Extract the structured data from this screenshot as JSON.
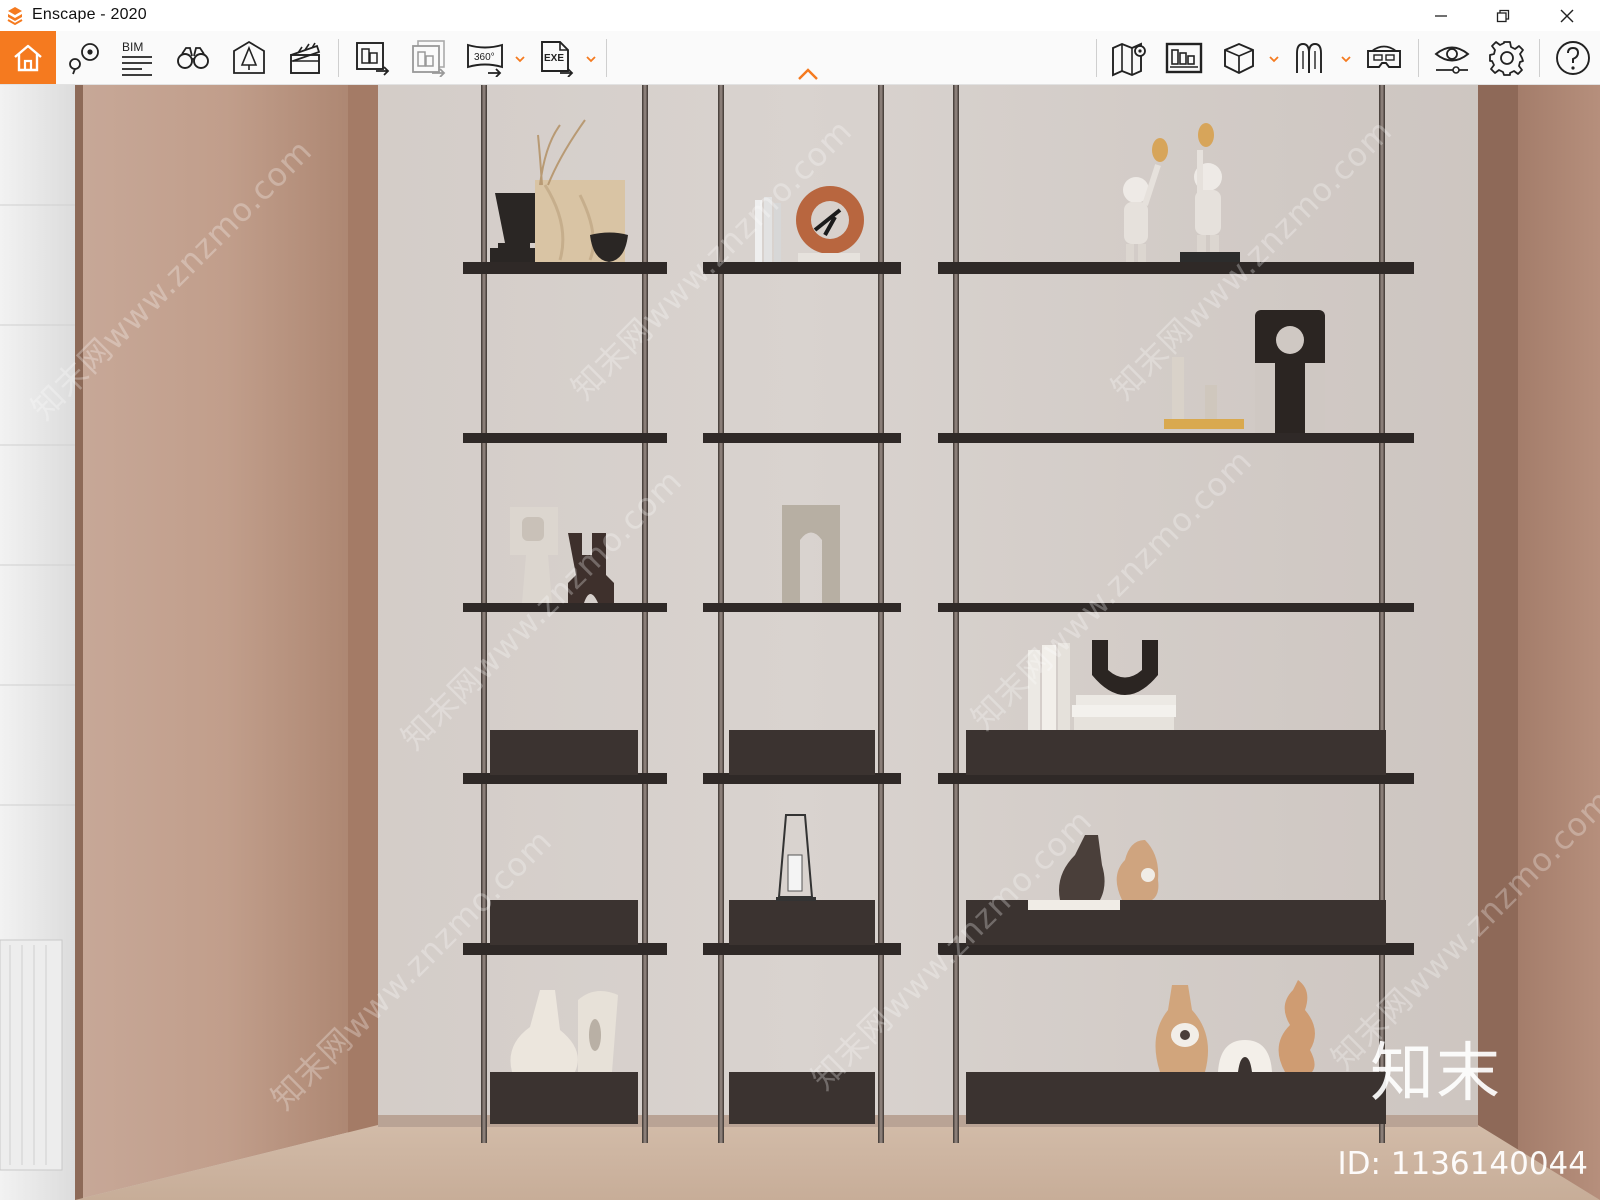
{
  "window": {
    "title": "Enscape - 2020",
    "accent": "#f57a1f"
  },
  "window_controls": [
    {
      "icon": "minimize-icon"
    },
    {
      "icon": "restore-icon"
    },
    {
      "icon": "close-icon"
    }
  ],
  "toolbar": {
    "bim_label": "BIM",
    "screenshot_360_label": "360°",
    "exe_label": "EXE",
    "left_tools": [
      {
        "name": "home",
        "icon": "home-icon"
      },
      {
        "name": "view-management",
        "icon": "location-pin-icon"
      },
      {
        "name": "bim",
        "icon": "bim-icon"
      },
      {
        "name": "walk-mode",
        "icon": "binoculars-icon"
      },
      {
        "name": "visual-settings",
        "icon": "house-outline-icon"
      },
      {
        "name": "video-editor",
        "icon": "clapperboard-icon"
      },
      {
        "name": "render-image",
        "icon": "render-image-icon"
      },
      {
        "name": "batch-render",
        "icon": "batch-render-icon"
      },
      {
        "name": "render-360",
        "icon": "panorama-360-icon"
      },
      {
        "name": "export-exe",
        "icon": "exe-export-icon"
      }
    ],
    "right_tools": [
      {
        "name": "map",
        "icon": "map-icon"
      },
      {
        "name": "gallery",
        "icon": "gallery-icon"
      },
      {
        "name": "asset-library",
        "icon": "cube-icon"
      },
      {
        "name": "material",
        "icon": "material-icon"
      },
      {
        "name": "vr-headset",
        "icon": "vr-headset-icon"
      },
      {
        "name": "visibility",
        "icon": "eye-icon"
      },
      {
        "name": "settings",
        "icon": "gear-icon"
      },
      {
        "name": "help",
        "icon": "help-icon"
      }
    ]
  },
  "viewport": {
    "watermark_text": "知末网www.znzmo.com",
    "logo_text": "知末",
    "image_id": "ID: 1136140044"
  }
}
